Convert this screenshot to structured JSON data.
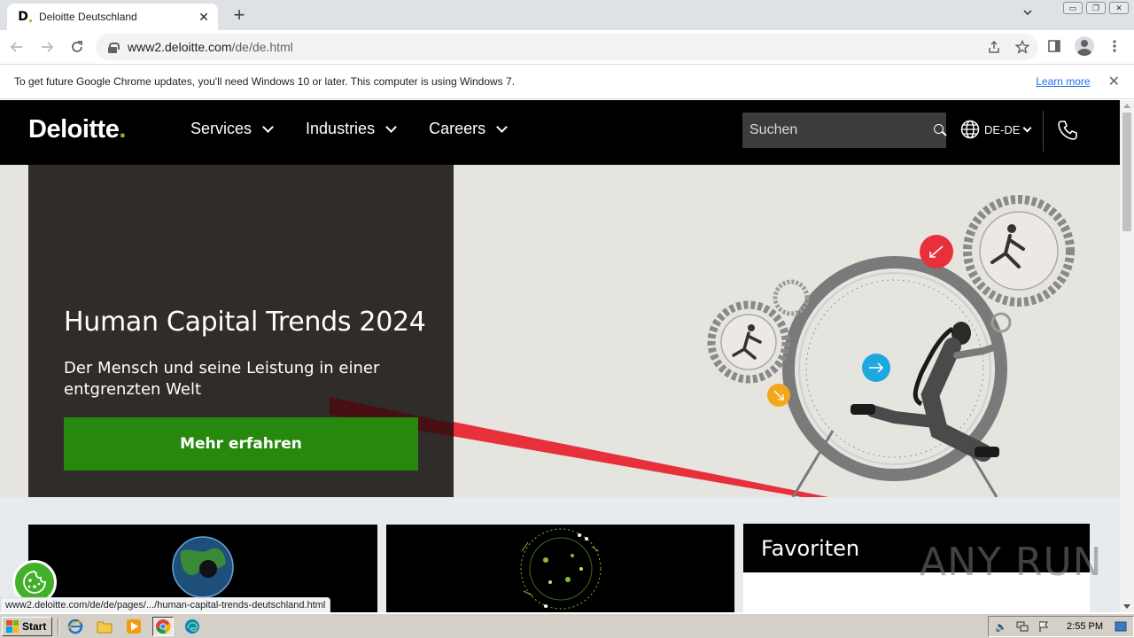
{
  "browser": {
    "tab": {
      "favicon": "D.",
      "title": "Deloitte Deutschland",
      "close": "✕"
    },
    "new_tab": "+",
    "url": {
      "host": "www2.deloitte.com",
      "path": "/de/de.html"
    },
    "infobar": {
      "message": "To get future Google Chrome updates, you'll need Windows 10 or later. This computer is using Windows 7.",
      "link": "Learn more"
    },
    "status_url": "www2.deloitte.com/de/de/pages/.../human-capital-trends-deutschland.html"
  },
  "site": {
    "logo_text": "Deloitte",
    "logo_dot": ".",
    "nav": [
      {
        "label": "Services"
      },
      {
        "label": "Industries"
      },
      {
        "label": "Careers"
      }
    ],
    "search_placeholder": "Suchen",
    "language": "DE-DE",
    "hero": {
      "title": "Human Capital Trends 2024",
      "subtitle": "Der Mensch und seine Leistung in einer entgrenzten Welt",
      "cta": "Mehr erfahren"
    },
    "favorites_title": "Favoriten"
  },
  "watermark": "ANY RUN",
  "taskbar": {
    "start": "Start",
    "clock": "2:55 PM"
  },
  "colors": {
    "brand_green": "#86bc25",
    "cta_green": "#26890d",
    "header_black": "#000000",
    "hero_panel": "#2f2c2a"
  }
}
